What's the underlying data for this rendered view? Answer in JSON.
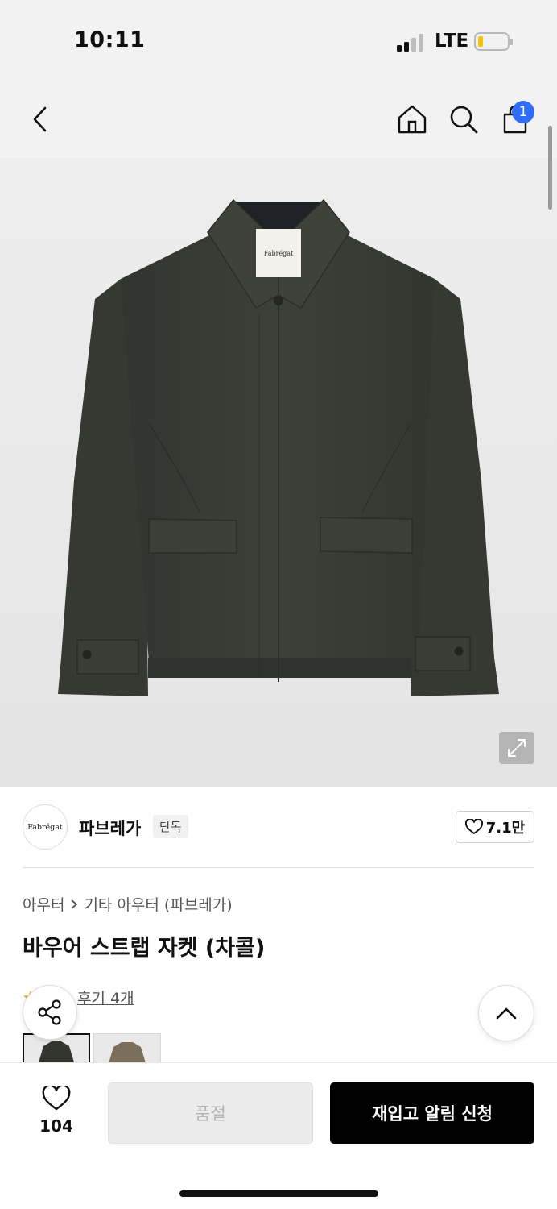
{
  "status_bar": {
    "time": "10:11",
    "network": "LTE"
  },
  "header": {
    "cart_count": "1"
  },
  "brand": {
    "logo_text": "Fabrégat",
    "name": "파브레가",
    "tag": "단독",
    "likes": "7.1만"
  },
  "product": {
    "breadcrumb": [
      "아우터",
      "기타 아우터 (파브레가)"
    ],
    "title": "바우어 스트랩 자켓 (차콜)",
    "review_text": "후기 4개",
    "label_text": "Fabrégat"
  },
  "bottom_bar": {
    "wish_count": "104",
    "soldout_label": "품절",
    "restock_label": "재입고 알림 신청"
  },
  "colors": {
    "accent_badge": "#2f6df6",
    "jacket": "#3a3d36",
    "swatch_alt": "#7b6f5c",
    "star": "#f5a623"
  }
}
